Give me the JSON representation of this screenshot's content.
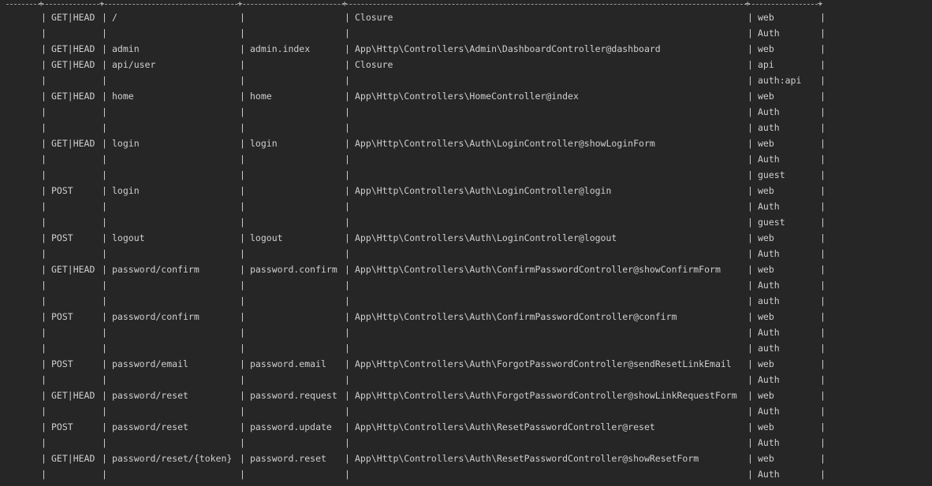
{
  "rows": [
    {
      "method": "GET|HEAD",
      "uri": "/",
      "name": "",
      "action": "Closure",
      "middleware": "web"
    },
    {
      "method": "",
      "uri": "",
      "name": "",
      "action": "",
      "middleware": "Auth"
    },
    {
      "method": "GET|HEAD",
      "uri": "admin",
      "name": "admin.index",
      "action": "App\\Http\\Controllers\\Admin\\DashboardController@dashboard",
      "middleware": "web"
    },
    {
      "method": "GET|HEAD",
      "uri": "api/user",
      "name": "",
      "action": "Closure",
      "middleware": "api"
    },
    {
      "method": "",
      "uri": "",
      "name": "",
      "action": "",
      "middleware": "auth:api"
    },
    {
      "method": "GET|HEAD",
      "uri": "home",
      "name": "home",
      "action": "App\\Http\\Controllers\\HomeController@index",
      "middleware": "web"
    },
    {
      "method": "",
      "uri": "",
      "name": "",
      "action": "",
      "middleware": "Auth"
    },
    {
      "method": "",
      "uri": "",
      "name": "",
      "action": "",
      "middleware": "auth"
    },
    {
      "method": "GET|HEAD",
      "uri": "login",
      "name": "login",
      "action": "App\\Http\\Controllers\\Auth\\LoginController@showLoginForm",
      "middleware": "web"
    },
    {
      "method": "",
      "uri": "",
      "name": "",
      "action": "",
      "middleware": "Auth"
    },
    {
      "method": "",
      "uri": "",
      "name": "",
      "action": "",
      "middleware": "guest"
    },
    {
      "method": "POST",
      "uri": "login",
      "name": "",
      "action": "App\\Http\\Controllers\\Auth\\LoginController@login",
      "middleware": "web"
    },
    {
      "method": "",
      "uri": "",
      "name": "",
      "action": "",
      "middleware": "Auth"
    },
    {
      "method": "",
      "uri": "",
      "name": "",
      "action": "",
      "middleware": "guest"
    },
    {
      "method": "POST",
      "uri": "logout",
      "name": "logout",
      "action": "App\\Http\\Controllers\\Auth\\LoginController@logout",
      "middleware": "web"
    },
    {
      "method": "",
      "uri": "",
      "name": "",
      "action": "",
      "middleware": "Auth"
    },
    {
      "method": "GET|HEAD",
      "uri": "password/confirm",
      "name": "password.confirm",
      "action": "App\\Http\\Controllers\\Auth\\ConfirmPasswordController@showConfirmForm",
      "middleware": "web"
    },
    {
      "method": "",
      "uri": "",
      "name": "",
      "action": "",
      "middleware": "Auth"
    },
    {
      "method": "",
      "uri": "",
      "name": "",
      "action": "",
      "middleware": "auth"
    },
    {
      "method": "POST",
      "uri": "password/confirm",
      "name": "",
      "action": "App\\Http\\Controllers\\Auth\\ConfirmPasswordController@confirm",
      "middleware": "web"
    },
    {
      "method": "",
      "uri": "",
      "name": "",
      "action": "",
      "middleware": "Auth"
    },
    {
      "method": "",
      "uri": "",
      "name": "",
      "action": "",
      "middleware": "auth"
    },
    {
      "method": "POST",
      "uri": "password/email",
      "name": "password.email",
      "action": "App\\Http\\Controllers\\Auth\\ForgotPasswordController@sendResetLinkEmail",
      "middleware": "web"
    },
    {
      "method": "",
      "uri": "",
      "name": "",
      "action": "",
      "middleware": "Auth"
    },
    {
      "method": "GET|HEAD",
      "uri": "password/reset",
      "name": "password.request",
      "action": "App\\Http\\Controllers\\Auth\\ForgotPasswordController@showLinkRequestForm",
      "middleware": "web"
    },
    {
      "method": "",
      "uri": "",
      "name": "",
      "action": "",
      "middleware": "Auth"
    },
    {
      "method": "POST",
      "uri": "password/reset",
      "name": "password.update",
      "action": "App\\Http\\Controllers\\Auth\\ResetPasswordController@reset",
      "middleware": "web"
    },
    {
      "method": "",
      "uri": "",
      "name": "",
      "action": "",
      "middleware": "Auth"
    },
    {
      "method": "GET|HEAD",
      "uri": "password/reset/{token}",
      "name": "password.reset",
      "action": "App\\Http\\Controllers\\Auth\\ResetPasswordController@showResetForm",
      "middleware": "web"
    },
    {
      "method": "",
      "uri": "",
      "name": "",
      "action": "",
      "middleware": "Auth"
    }
  ]
}
